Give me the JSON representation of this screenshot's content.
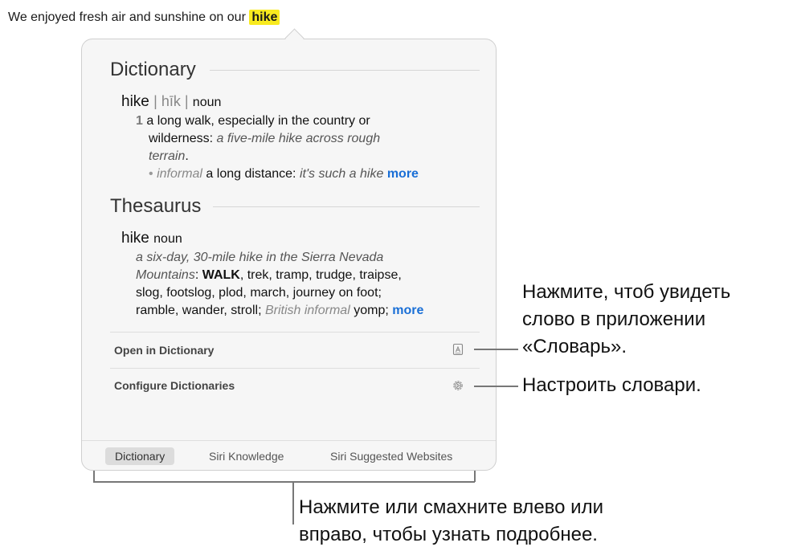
{
  "sentence": {
    "before": "We enjoyed fresh air and sunshine on our ",
    "highlight": "hike"
  },
  "dictionary": {
    "title": "Dictionary",
    "word": "hike",
    "pronunciation": "| hīk |",
    "pos": "noun",
    "sense_number": "1",
    "def_line1": "a long walk, especially in the country or",
    "def_line2_plain": "wilderness: ",
    "def_line2_example": "a five-mile hike across rough",
    "def_line3_example": "terrain",
    "def_line3_end": ".",
    "subsense_bullet": "•",
    "subsense_register": "informal",
    "subsense_text": " a long distance: ",
    "subsense_example": "it's such a hike ",
    "more": "more"
  },
  "thesaurus": {
    "title": "Thesaurus",
    "word": "hike",
    "pos": "noun",
    "example_line1": "a six-day, 30-mile hike in the Sierra Nevada",
    "example_line2": "Mountains",
    "colon": ": ",
    "syn_main": "WALK",
    "syn_line2_rest": ", trek, tramp, trudge, traipse,",
    "syn_line3": "slog, footslog, plod, march, journey on foot;",
    "syn_line4": "ramble, wander, stroll; ",
    "syn_register": "British informal",
    "syn_line4_end": " yomp; ",
    "more": "more"
  },
  "actions": {
    "open_in_dictionary": "Open in Dictionary",
    "configure_dictionaries": "Configure Dictionaries"
  },
  "icons": {
    "open": "dictionary-book-icon",
    "configure": "gear-icon"
  },
  "tabs": [
    {
      "label": "Dictionary",
      "active": true
    },
    {
      "label": "Siri Knowledge",
      "active": false
    },
    {
      "label": "Siri Suggested Websites",
      "active": false
    }
  ],
  "callouts": {
    "open_line1": "Нажмите, чтоб увидеть",
    "open_line2": "слово в приложении",
    "open_line3": "«Словарь».",
    "configure": "Настроить словари.",
    "tabs_line1": "Нажмите или смахните влево или",
    "tabs_line2": "вправо, чтобы узнать подробнее."
  },
  "colors": {
    "highlight": "#f8ea1f",
    "link": "#1a6fd6",
    "popover_bg": "#f6f6f6"
  }
}
